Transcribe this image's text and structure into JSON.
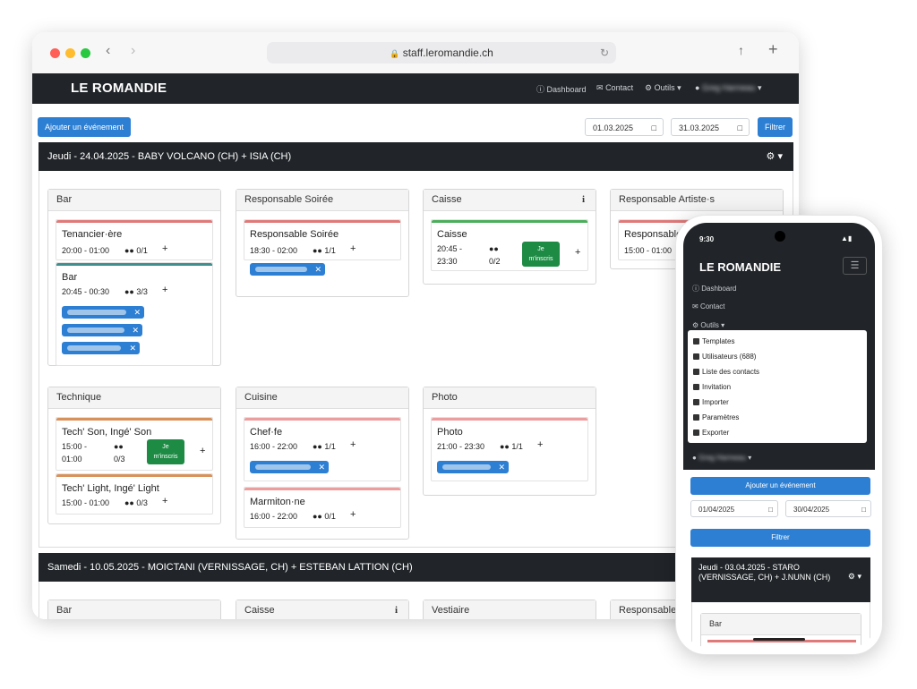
{
  "browser": {
    "url": "staff.leromandie.ch"
  },
  "nav": {
    "brand": "LE ROMANDIE",
    "dashboard": "Dashboard",
    "contact": "Contact",
    "outils": "Outils",
    "user": "Greg Harmeau"
  },
  "toolbar": {
    "add_event": "Ajouter un événement",
    "date_from": "01.03.2025",
    "date_to": "31.03.2025",
    "filter": "Filtrer"
  },
  "events": [
    {
      "title": "Jeudi - 24.04.2025 - BABY VOLCANO (CH) + ISIA (CH)",
      "panels": [
        {
          "name": "Bar",
          "slots": [
            {
              "title": "Tenancier·ère",
              "time": "20:00 - 01:00",
              "count": "0/1"
            },
            {
              "title": "Bar",
              "time": "20:45 - 00:30",
              "count": "3/3"
            }
          ]
        },
        {
          "name": "Responsable Soirée",
          "slots": [
            {
              "title": "Responsable Soirée",
              "time": "18:30 - 02:00",
              "count": "1/1"
            }
          ]
        },
        {
          "name": "Caisse",
          "info": "i",
          "slots": [
            {
              "title": "Caisse",
              "time_a": "20:45 -",
              "time_b": "23:30",
              "count": "0/2",
              "signup_a": "Je",
              "signup_b": "m'inscris"
            }
          ]
        },
        {
          "name": "Responsable Artiste·s",
          "slots": [
            {
              "title": "Responsable",
              "time": "15:00 - 01:00"
            }
          ]
        },
        {
          "name": "Technique",
          "slots": [
            {
              "title": "Tech' Son, Ingé' Son",
              "time_a": "15:00 -",
              "time_b": "01:00",
              "count": "0/3",
              "signup_a": "Je",
              "signup_b": "m'inscris"
            },
            {
              "title": "Tech' Light, Ingé' Light",
              "time": "15:00 - 01:00",
              "count": "0/3"
            }
          ]
        },
        {
          "name": "Cuisine",
          "slots": [
            {
              "title": "Chef·fe",
              "time": "16:00 - 22:00",
              "count": "1/1"
            },
            {
              "title": "Marmiton·ne",
              "time": "16:00 - 22:00",
              "count": "0/1"
            }
          ]
        },
        {
          "name": "Photo",
          "slots": [
            {
              "title": "Photo",
              "time": "21:00 - 23:30",
              "count": "1/1"
            }
          ]
        }
      ]
    },
    {
      "title": "Samedi - 10.05.2025 - MOICTANI (VERNISSAGE, CH) + ESTEBAN LATTION (CH)",
      "panels": [
        {
          "name": "Bar"
        },
        {
          "name": "Caisse",
          "info": "i"
        },
        {
          "name": "Vestiaire"
        },
        {
          "name": "Responsable"
        }
      ]
    }
  ],
  "phone": {
    "time": "9:30",
    "brand": "LE ROMANDIE",
    "dashboard": "Dashboard",
    "contact": "Contact",
    "outils": "Outils",
    "menu": [
      "Templates",
      "Utilisateurs (688)",
      "Liste des contacts",
      "Invitation",
      "Importer",
      "Paramètres",
      "Exporter"
    ],
    "user": "Greg Harmeau",
    "add_event": "Ajouter un événement",
    "date_from": "01/04/2025",
    "date_to": "30/04/2025",
    "filter": "Filtrer",
    "event_title": "Jeudi - 03.04.2025 - STARO (VERNISSAGE, CH) + J.NUNN (CH)",
    "panel": "Bar"
  },
  "colors": {
    "navbar": "#212529",
    "primary": "#2d7fd3",
    "success": "#1e8b45",
    "slot_red": "#e07a7a",
    "slot_teal": "#3f8f8f",
    "slot_green": "#4cae5a",
    "slot_orange": "#d9915a",
    "slot_pink": "#ec9d9d"
  }
}
